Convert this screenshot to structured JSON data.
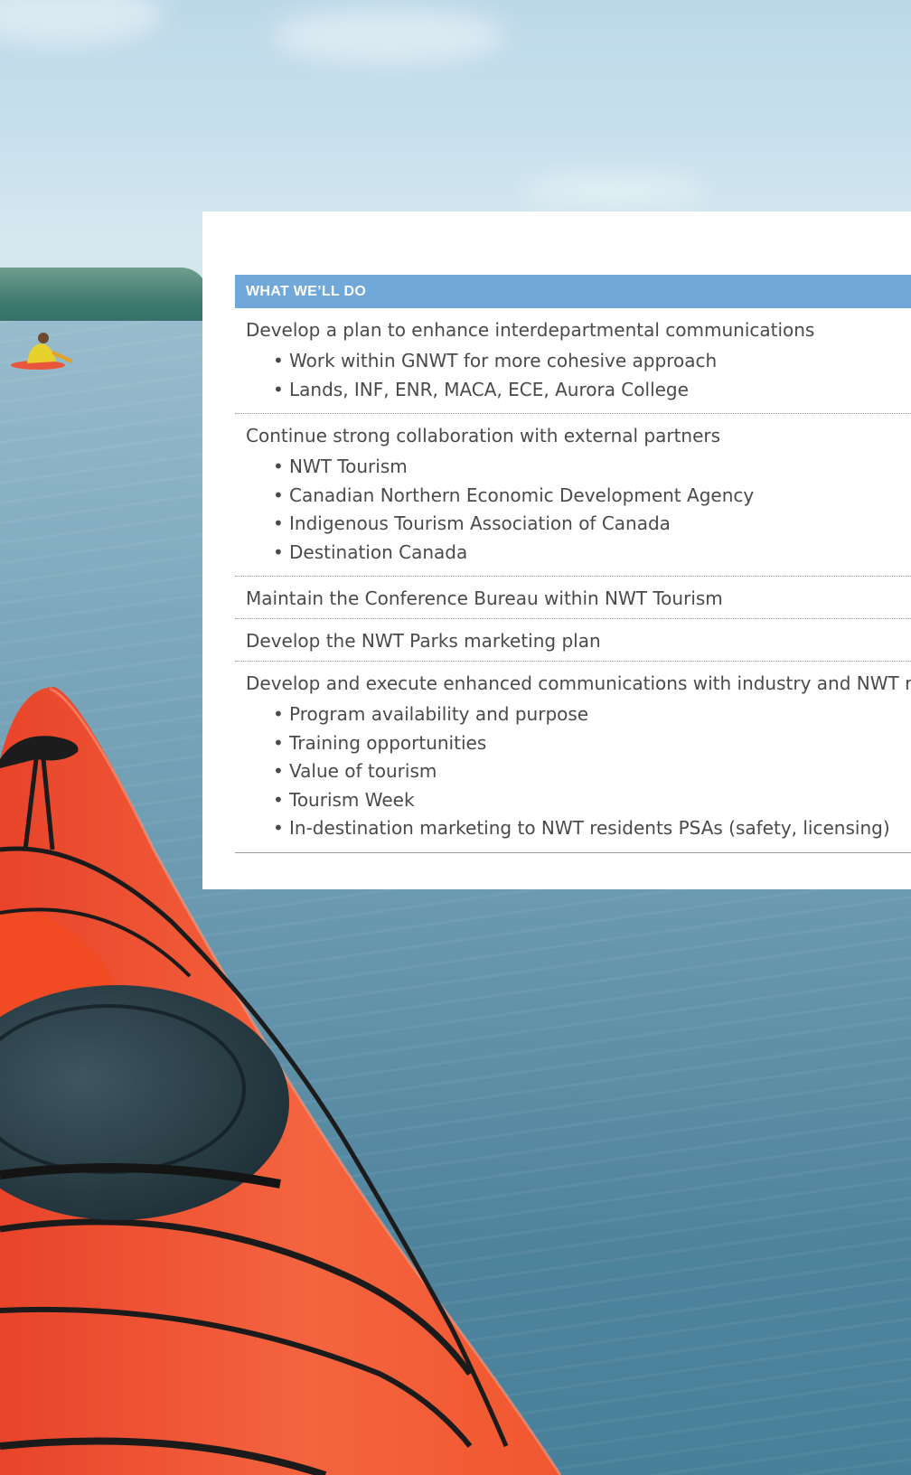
{
  "table": {
    "header": "WHAT WE’LL DO",
    "groups": [
      {
        "title": "Develop a plan to enhance interdepartmental communications",
        "bullets": [
          "Work within GNWT for more cohesive approach",
          "Lands, INF, ENR, MACA, ECE, Aurora College"
        ]
      },
      {
        "title": "Continue strong collaboration with external partners",
        "bullets": [
          "NWT Tourism",
          "Canadian Northern Economic Development Agency",
          "Indigenous Tourism Association of Canada",
          "Destination Canada"
        ]
      },
      {
        "title": "Maintain the Conference Bureau within NWT Tourism",
        "bullets": []
      },
      {
        "title": "Develop the NWT Parks marketing plan",
        "bullets": []
      },
      {
        "title": "Develop and execute enhanced communications with industry and NWT reside",
        "bullets": [
          "Program availability and purpose",
          "Training opportunities",
          "Value of tourism",
          "Tourism Week",
          "In-destination marketing to NWT residents PSAs (safety, licensing)"
        ]
      }
    ]
  },
  "colors": {
    "header_bg": "#6fa8d9",
    "text": "#4a4a4a",
    "kayak": "#f2573a"
  }
}
